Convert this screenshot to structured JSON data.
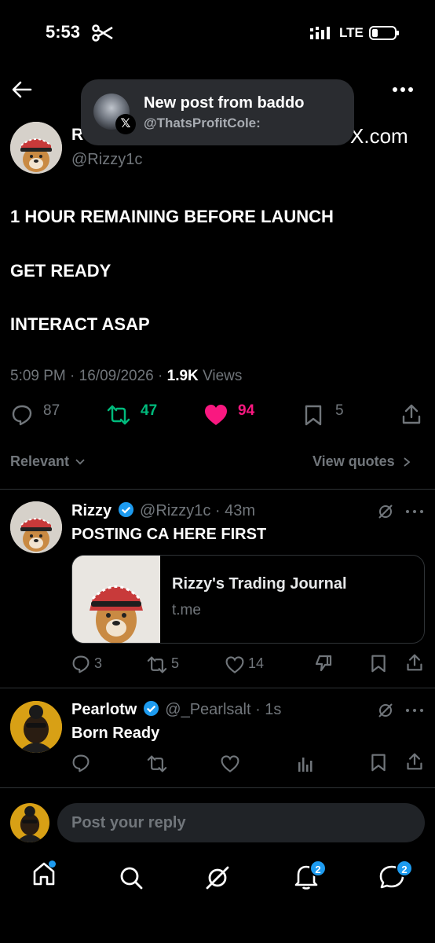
{
  "status_bar": {
    "time": "5:53",
    "network": "LTE"
  },
  "notification": {
    "title": "New post from baddo",
    "handle": "@ThatsProfitCole:",
    "app_badge": "𝕏"
  },
  "post": {
    "author_name_partial": "R",
    "author_handle": "@Rizzy1c",
    "overlay_text": "X.com",
    "lines": [
      "1 HOUR REMAINING BEFORE LAUNCH",
      "GET READY",
      "INTERACT ASAP"
    ],
    "time": "5:09 PM",
    "date": "16/09/2026",
    "views_count": "1.9K",
    "views_label": "Views",
    "replies": "87",
    "reposts": "47",
    "likes": "94",
    "bookmarks": "5"
  },
  "filters": {
    "sort": "Relevant",
    "view_quotes": "View quotes"
  },
  "replies": [
    {
      "name": "Rizzy",
      "handle": "@Rizzy1c",
      "time": "43m",
      "text": "POSTING CA HERE FIRST",
      "card": {
        "title": "Rizzy's Trading Journal",
        "domain": "t.me"
      },
      "replies": "3",
      "reposts": "5",
      "likes": "14"
    },
    {
      "name": "Pearlotw",
      "handle": "@_Pearlsalt",
      "time": "1s",
      "text": "Born Ready"
    }
  ],
  "composer": {
    "placeholder": "Post your reply"
  },
  "bottom_nav": {
    "notifications_badge": "2",
    "messages_badge": "2"
  },
  "colors": {
    "repost": "#00ba7c",
    "like": "#f91880",
    "verified": "#1d9bf0",
    "muted": "#71767b"
  }
}
